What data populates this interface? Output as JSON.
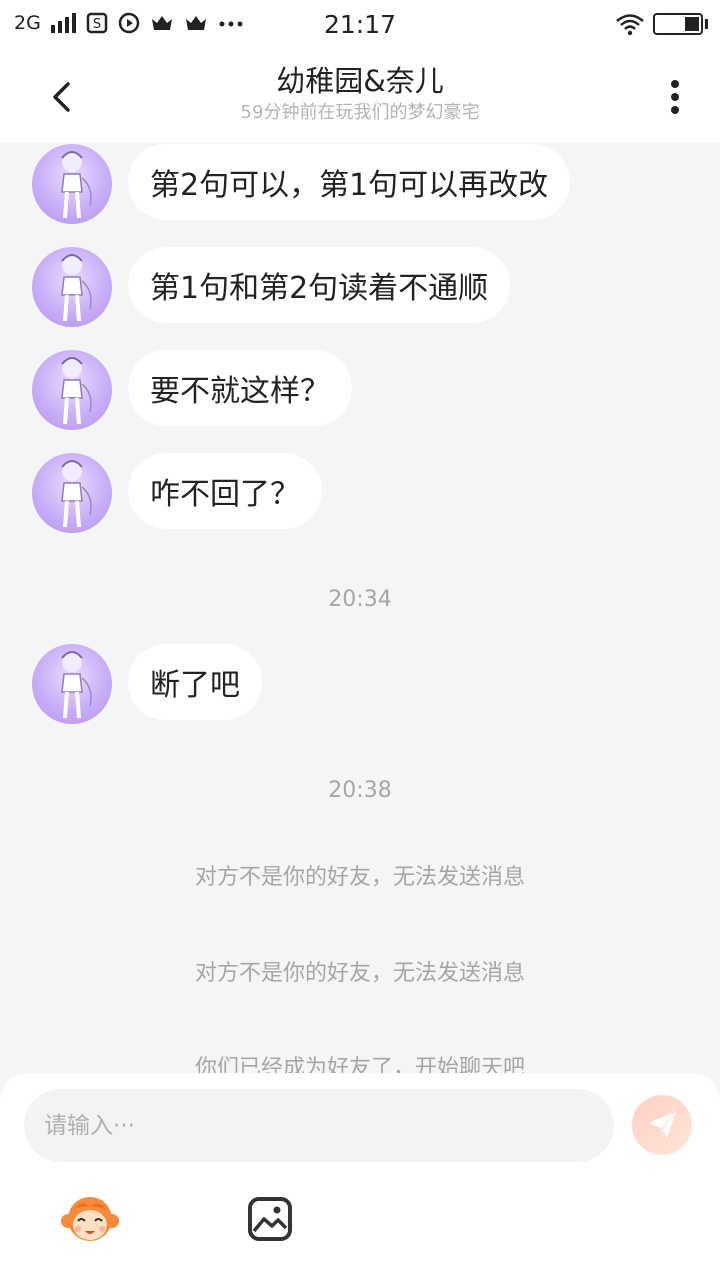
{
  "status_bar": {
    "network": "2G",
    "time": "21:17"
  },
  "header": {
    "title": "幼稚园&奈儿",
    "subtitle": "59分钟前在玩我们的梦幻豪宅"
  },
  "messages": [
    {
      "text": "第2句可以，第1句可以再改改"
    },
    {
      "text": "第1句和第2句读着不通顺"
    },
    {
      "text": "要不就这样？"
    },
    {
      "text": "咋不回了？"
    },
    {
      "text": "断了吧"
    }
  ],
  "timestamps": [
    "20:34",
    "20:38"
  ],
  "system_messages": [
    "对方不是你的好友，无法发送消息",
    "对方不是你的好友，无法发送消息",
    "你们已经成为好友了，开始聊天吧"
  ],
  "input": {
    "placeholder": "请输入···"
  },
  "icons": {
    "back": "chevron-left-icon",
    "more": "more-vertical-icon",
    "send": "paper-plane-icon",
    "emoji": "monkey-face-icon",
    "image": "image-icon"
  },
  "colors": {
    "background": "#f4f5f7",
    "bubble": "#ffffff",
    "avatar": "#c9aef7",
    "send_button": "#ffd0c4",
    "muted_text": "#a6a6a6"
  }
}
